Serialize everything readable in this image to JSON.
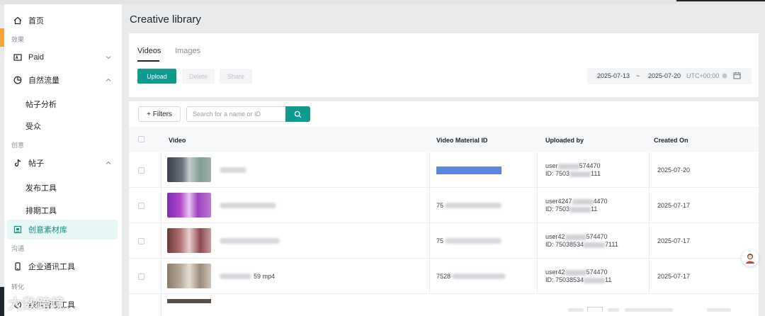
{
  "sidebar": {
    "home": "首页",
    "group_effect": "效果",
    "paid": "Paid",
    "organic": "自然流量",
    "post_analysis": "帖子分析",
    "audience": "受众",
    "group_creative": "创意",
    "posts": "帖子",
    "publish_tool": "发布工具",
    "schedule_tool": "排期工具",
    "creative_library": "创意素材库",
    "group_communication": "沟通",
    "enterprise_im": "企业通讯工具",
    "group_conversion": "转化",
    "leads_management": "线索管理工具"
  },
  "page": {
    "title": "Creative library"
  },
  "tabs": {
    "videos": "Videos",
    "images": "Images"
  },
  "toolbar": {
    "upload": "Upload",
    "delete": "Delete",
    "share": "Share"
  },
  "daterange": {
    "start": "2025-07-13",
    "sep": "~",
    "end": "2025-07-20",
    "timezone": "UTC+00:00"
  },
  "filters": {
    "label": "+ Filters",
    "search_placeholder": "Search for a name or ID"
  },
  "table": {
    "headers": {
      "video": "Video",
      "material_id": "Video Material ID",
      "uploaded_by": "Uploaded by",
      "created_on": "Created On"
    },
    "rows": [
      {
        "uploaded_user": "user",
        "uploaded_user_tail": "574470",
        "uploaded_id": "ID: 7503",
        "uploaded_id_tail": "111",
        "created": "2025-07-20"
      },
      {
        "material_prefix": "75",
        "uploaded_user": "user4247",
        "uploaded_user_tail": "4470",
        "uploaded_id": "ID: 7503",
        "uploaded_id_tail": "11",
        "created": "2025-07-17"
      },
      {
        "material_prefix": "75",
        "uploaded_user": "user42",
        "uploaded_user_tail": "574470",
        "uploaded_id": "ID: 75038534",
        "uploaded_id_tail": "7111",
        "created": "2025-07-17"
      },
      {
        "video_suffix": "59 mp4",
        "material_prefix": "7528",
        "uploaded_user": "user42",
        "uploaded_user_tail": "574470",
        "uploaded_id": "ID: 75038534",
        "uploaded_id_tail": "11",
        "created": "2025-07-17"
      }
    ]
  },
  "watermark": "大数跨境",
  "colors": {
    "accent": "#0e9a8f",
    "active_bg": "#e6f7f6",
    "redaction_blue": "#5b87e0"
  }
}
